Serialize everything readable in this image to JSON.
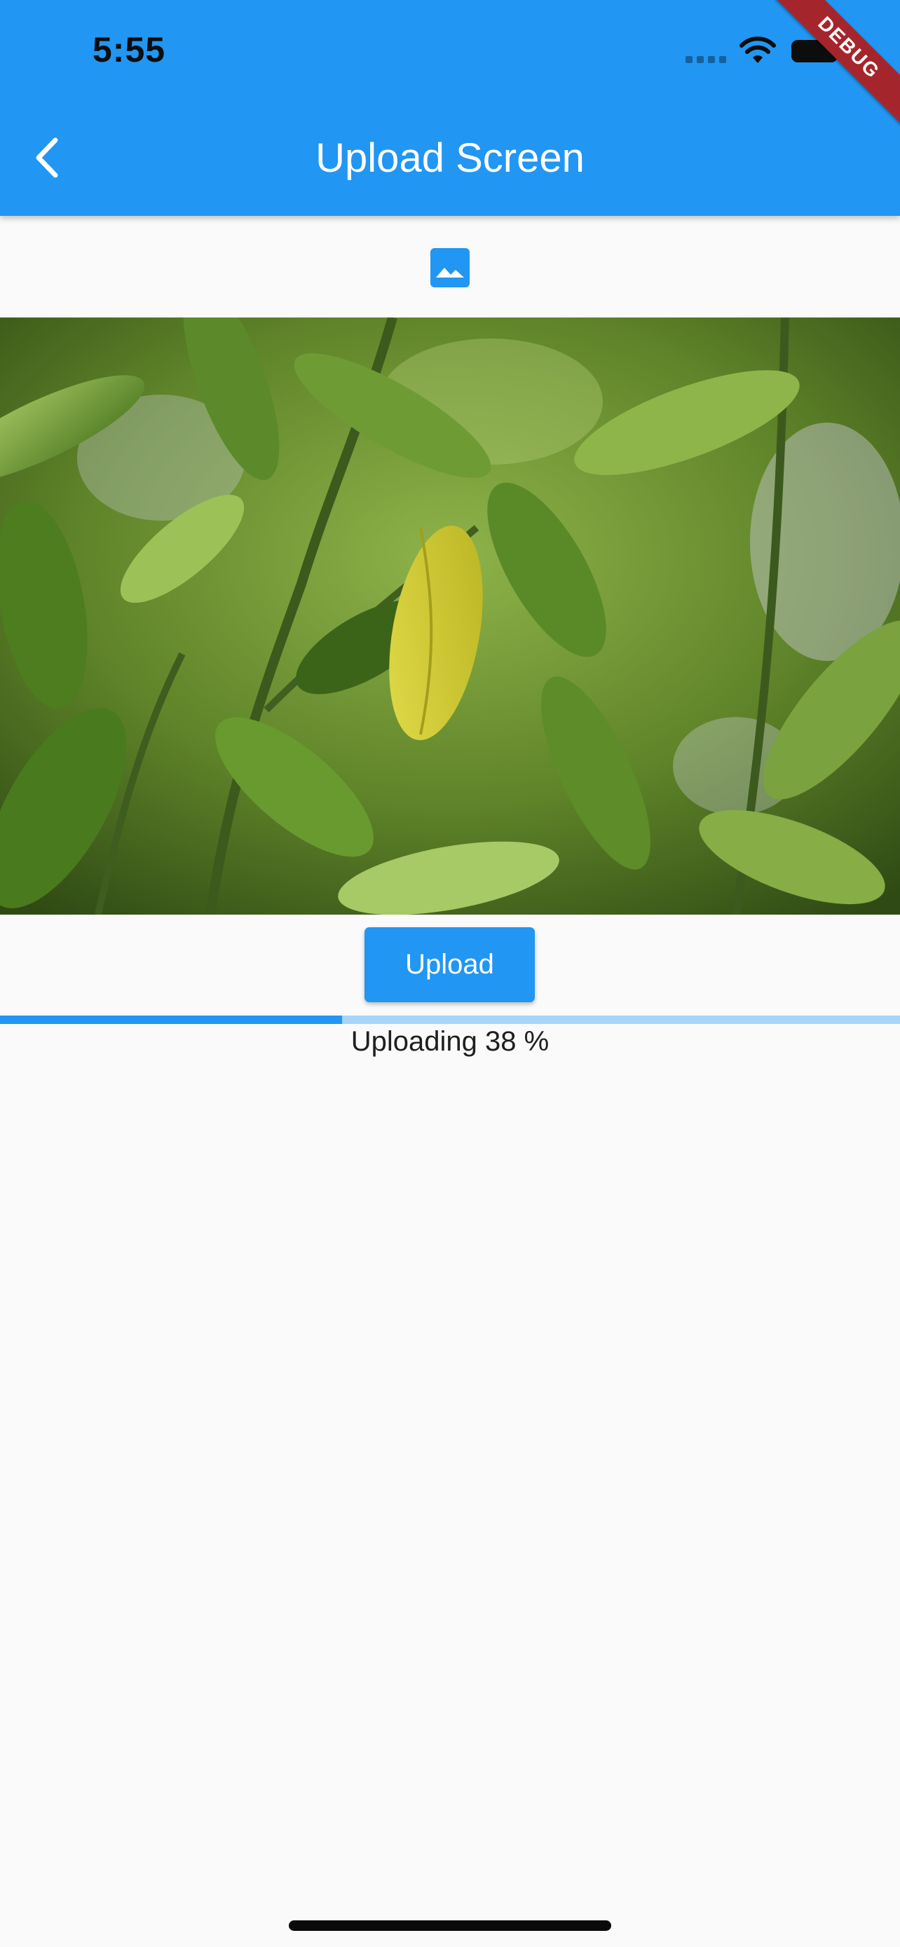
{
  "status_bar": {
    "time": "5:55",
    "signal_icon": "cellular-signal-icon",
    "wifi_icon": "wifi-icon",
    "battery_icon": "battery-icon"
  },
  "app_bar": {
    "title": "Upload Screen",
    "back_icon": "chevron-left-icon",
    "background_color": "#2196f3",
    "title_color": "#ffffff"
  },
  "debug_banner": {
    "label": "DEBUG",
    "color": "#a4262c"
  },
  "image_picker": {
    "icon": "image-icon",
    "color": "#2196f3"
  },
  "preview": {
    "subject": "green citrus leaves with one yellow leaf"
  },
  "upload": {
    "button_label": "Upload",
    "progress_fraction": 0.38,
    "progress_text": "Uploading 38 %",
    "track_color": "#a6d4fa",
    "fill_color": "#2196f3"
  }
}
